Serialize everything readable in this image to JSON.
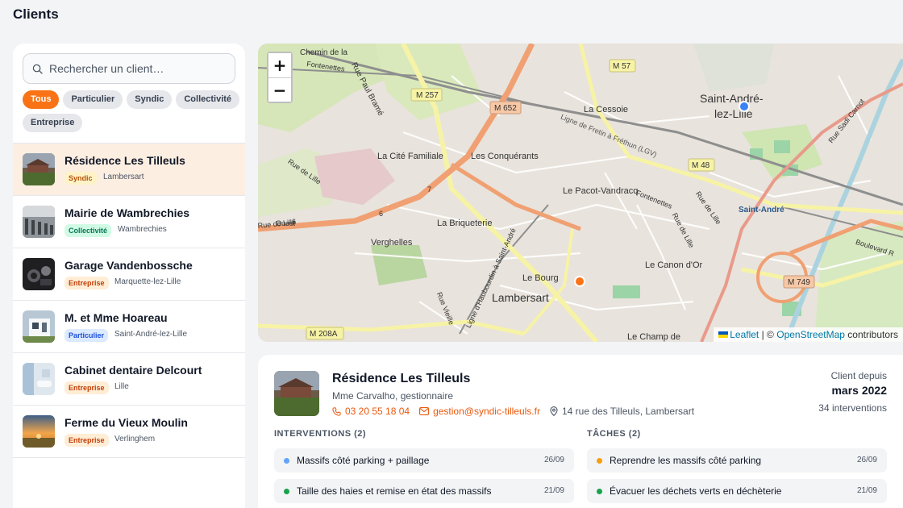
{
  "page": {
    "title": "Clients"
  },
  "search": {
    "placeholder": "Rechercher un client…"
  },
  "filters": [
    "Tous",
    "Particulier",
    "Syndic",
    "Collectivité",
    "Entreprise"
  ],
  "clients": [
    {
      "name": "Résidence Les Tilleuls",
      "type": "Syndic",
      "city": "Lambersart"
    },
    {
      "name": "Mairie de Wambrechies",
      "type": "Collectivité",
      "city": "Wambrechies"
    },
    {
      "name": "Garage Vandenbossche",
      "type": "Entreprise",
      "city": "Marquette-lez-Lille"
    },
    {
      "name": "M. et Mme Hoareau",
      "type": "Particulier",
      "city": "Saint-André-lez-Lille"
    },
    {
      "name": "Cabinet dentaire Delcourt",
      "type": "Entreprise",
      "city": "Lille"
    },
    {
      "name": "Ferme du Vieux Moulin",
      "type": "Entreprise",
      "city": "Verlinghem"
    }
  ],
  "map": {
    "zoom_in": "+",
    "zoom_out": "−",
    "labels": [
      "Chemin de la",
      "Rue Paul Bramé",
      "M 257",
      "M 652",
      "M 57",
      "Saint-André-",
      "lez-Lille",
      "La Cessoie",
      "La Cité Familiale",
      "Les Conquérants",
      "M 48",
      "Rue de Lille",
      "Le Pacot-Vandracq",
      "Saint-André",
      "La Briqueterie",
      "Verghelles",
      "Le Bourg",
      "Lambersart",
      "Le Canon d'Or",
      "M 749",
      "M 208A",
      "Le Champ de",
      "Boulevard R",
      "Rue Sadi Carnot",
      "Ligne de Fretin à Fréthun (LGV)",
      "Rue de Lille",
      "Rue Vieille",
      "Ligne d'Haubourdin à Saint-André",
      "Rue de Lille",
      "Rue de Lille",
      "Fontenettes",
      "Fontenettes",
      "Ouest",
      "6",
      "7",
      "6"
    ],
    "attribution": {
      "leaflet": "Leaflet",
      "separator": "| ©",
      "osm": "OpenStreetMap",
      "suffix": "contributors"
    }
  },
  "detail": {
    "name": "Résidence Les Tilleuls",
    "contact": "Mme Carvalho, gestionnaire",
    "phone": "03 20 55 18 04",
    "email": "gestion@syndic-tilleuls.fr",
    "address": "14 rue des Tilleuls, Lambersart",
    "since_label": "Client depuis",
    "since_date": "mars 2022",
    "interventions_count": "34 interventions",
    "interventions_title": "INTERVENTIONS (2)",
    "tasks_title": "TÂCHES (2)",
    "interventions": [
      {
        "text": "Massifs côté parking + paillage",
        "date": "26/09"
      },
      {
        "text": "Taille des haies et remise en état des massifs",
        "date": "21/09"
      }
    ],
    "tasks": [
      {
        "text": "Reprendre les massifs côté parking",
        "date": "26/09"
      },
      {
        "text": "Évacuer les déchets verts en déchèterie",
        "date": "21/09"
      }
    ]
  },
  "colors": {
    "accent": "#f97316",
    "syndic_badge_bg": "#fef3c7",
    "syndic_badge_fg": "#b45309",
    "collectivite_badge_bg": "#d1fae5",
    "collectivite_badge_fg": "#047857",
    "entreprise_badge_bg": "#ffedd5",
    "entreprise_badge_fg": "#c2410c",
    "particulier_badge_bg": "#dbeafe",
    "particulier_badge_fg": "#1d4ed8",
    "intervention_dot_1": "#60a5fa",
    "intervention_dot_2": "#16a34a",
    "task_dot_1": "#f59e0b",
    "task_dot_2": "#16a34a"
  }
}
